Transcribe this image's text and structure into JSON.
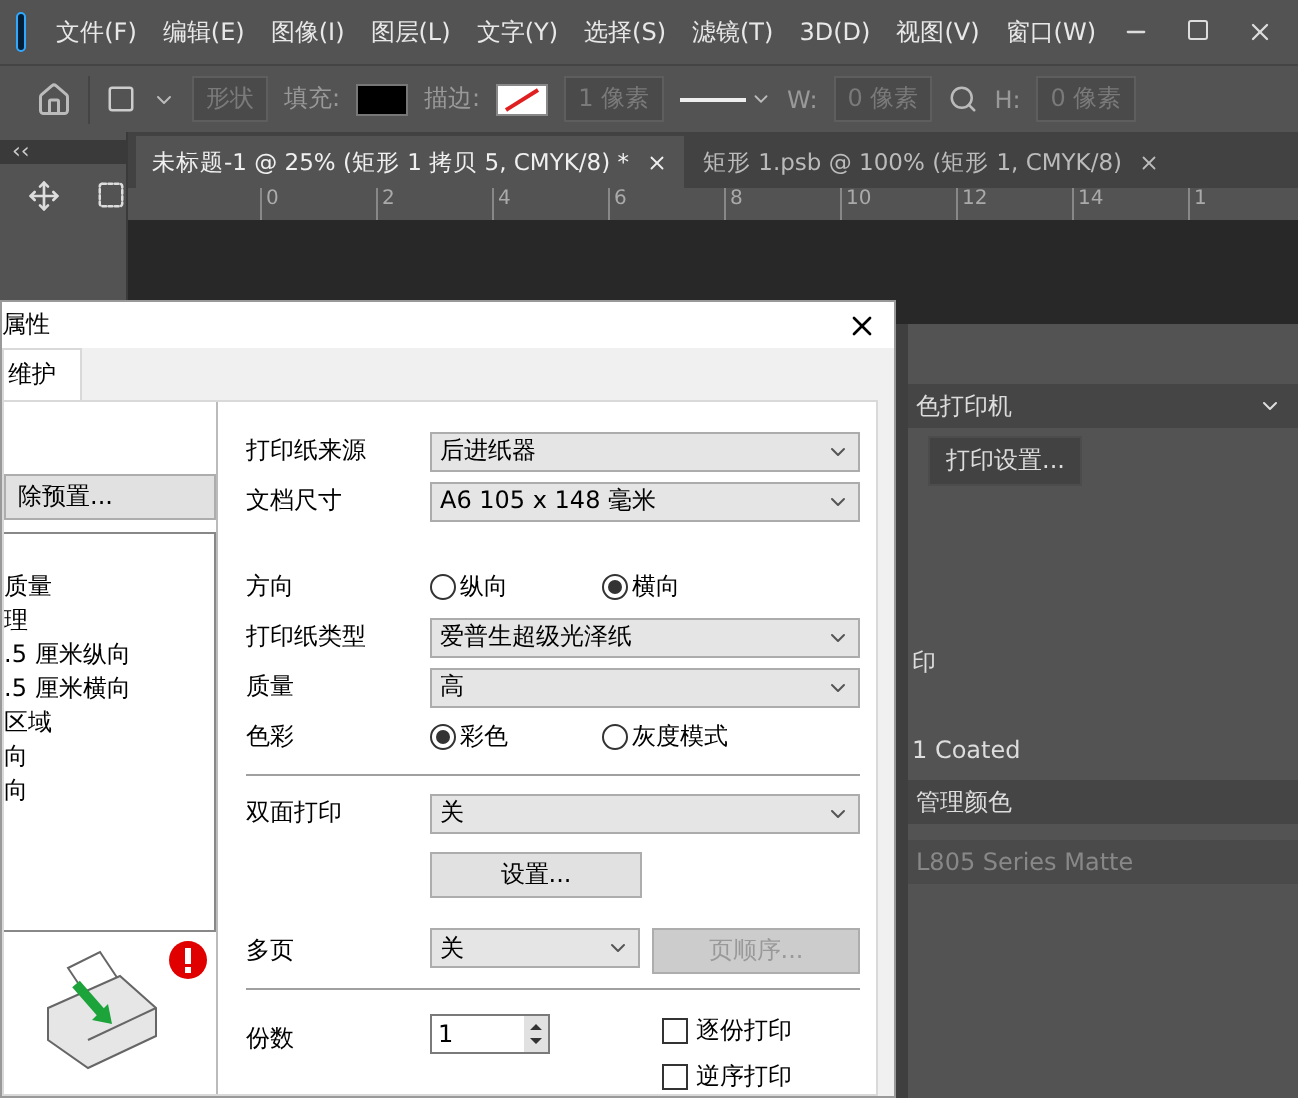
{
  "menu": [
    "文件(F)",
    "编辑(E)",
    "图像(I)",
    "图层(L)",
    "文字(Y)",
    "选择(S)",
    "滤镜(T)",
    "3D(D)",
    "视图(V)",
    "窗口(W)"
  ],
  "options_bar": {
    "shape_mode": "形状",
    "shape_mode_disabled": true,
    "fill_label": "填充:",
    "stroke_label": "描边:",
    "stroke_width": "1 像素",
    "w_label": "W:",
    "w_value": "0 像素",
    "h_label": "H:",
    "h_value": "0 像素"
  },
  "tool_panel": {
    "collapse_label": "‹‹"
  },
  "tabs": [
    {
      "label": "未标题-1 @ 25% (矩形 1 拷贝 5, CMYK/8) *",
      "selected": true
    },
    {
      "label": "矩形 1.psb @ 100% (矩形 1, CMYK/8)",
      "selected": false
    }
  ],
  "ruler": [
    "0",
    "2",
    "4",
    "6",
    "8",
    "10",
    "12",
    "14",
    "1"
  ],
  "printer_dialog": {
    "title": "属性",
    "tab": "维护",
    "preset_button": "除预置...",
    "preset_list": [
      "质量",
      "理",
      ".5 厘米纵向",
      ".5 厘米横向",
      "区域",
      "向",
      "向"
    ],
    "fields": [
      {
        "kind": "select",
        "label": "打印纸来源",
        "value": "后进纸器"
      },
      {
        "kind": "select",
        "label": "文档尺寸",
        "value": "A6 105 x 148 毫米"
      },
      {
        "kind": "radio",
        "label": "方向",
        "options": [
          {
            "label": "纵向",
            "selected": false
          },
          {
            "label": "横向",
            "selected": true
          }
        ]
      },
      {
        "kind": "select",
        "label": "打印纸类型",
        "value": "爱普生超级光泽纸"
      },
      {
        "kind": "select",
        "label": "质量",
        "value": "高"
      },
      {
        "kind": "radio",
        "label": "色彩",
        "options": [
          {
            "label": "彩色",
            "selected": true
          },
          {
            "label": "灰度模式",
            "selected": false
          }
        ]
      },
      {
        "kind": "divider"
      },
      {
        "kind": "select",
        "label": "双面打印",
        "value": "关"
      },
      {
        "kind": "button",
        "label": "设置..."
      },
      {
        "kind": "select_button",
        "label": "多页",
        "value": "关",
        "button": "页顺序...",
        "button_disabled": true
      },
      {
        "kind": "divider"
      },
      {
        "kind": "copies",
        "label": "份数",
        "value": "1",
        "checks": [
          {
            "label": "逐份打印",
            "checked": false
          },
          {
            "label": "逆序打印",
            "checked": false
          }
        ]
      }
    ]
  },
  "ps_print_panel": {
    "printer": "色打印机",
    "settings_button": "打印设置...",
    "partial_label": "印",
    "profile": "1 Coated",
    "color_handling": "管理颜色",
    "printer_profile": "L805 Series Matte"
  }
}
